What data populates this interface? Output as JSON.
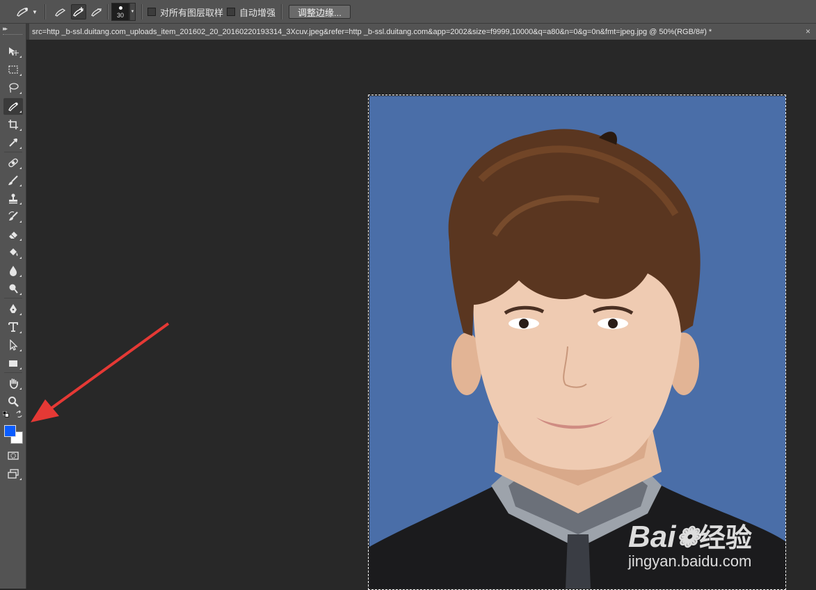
{
  "options_bar": {
    "tool_preset_icon": "quick-selection-brush-icon",
    "mode_icons": [
      "new-selection-icon",
      "add-to-selection-icon",
      "subtract-from-selection-icon"
    ],
    "brush_size": "30",
    "sample_all_layers": {
      "label": "对所有图层取样",
      "checked": false
    },
    "auto_enhance": {
      "label": "自动增强",
      "checked": false
    },
    "refine_edge_button": "调整边缘..."
  },
  "document_tab": {
    "title": "src=http _b-ssl.duitang.com_uploads_item_201602_20_20160220193314_3Xcuv.jpeg&refer=http _b-ssl.duitang.com&app=2002&size=f9999,10000&q=a80&n=0&g=0n&fmt=jpeg.jpg @ 50%(RGB/8#) *",
    "close_glyph": "×"
  },
  "toolbar": {
    "tools": [
      "move",
      "rectangular-marquee",
      "lasso",
      "quick-selection",
      "crop",
      "eyedropper",
      "spot-healing",
      "brush",
      "clone-stamp",
      "history-brush",
      "eraser",
      "paint-bucket",
      "blur",
      "dodge",
      "pen",
      "type",
      "path-selection",
      "rectangle",
      "hand",
      "zoom"
    ],
    "foreground_color": "#0a5cff",
    "background_color": "#ffffff"
  },
  "watermark": {
    "logo_text": "Bai",
    "logo_tail": "经验",
    "url": "jingyan.baidu.com"
  },
  "colors": {
    "photo_background": "#4a6ea8",
    "annotation_arrow": "#e53935"
  }
}
